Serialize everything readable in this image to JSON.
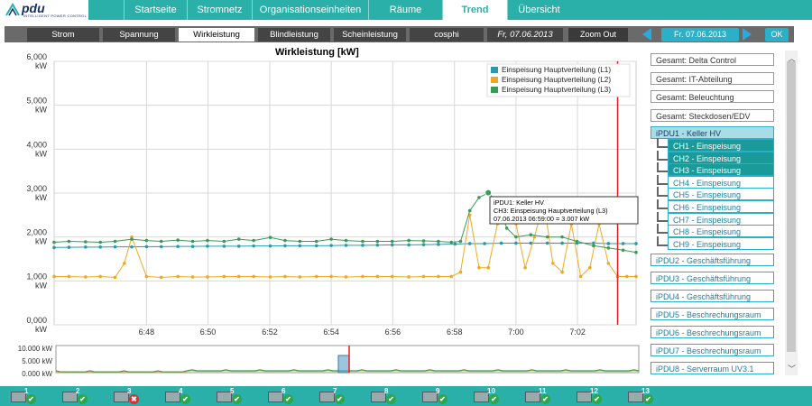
{
  "app": {
    "logo_text": "pdu",
    "logo_sub": "INTELLIGENT POWER CONTROL"
  },
  "nav": {
    "tabs": [
      {
        "label": "Startseite",
        "active": false
      },
      {
        "label": "Stromnetz",
        "active": false
      },
      {
        "label": "Organisationseinheiten",
        "active": false
      },
      {
        "label": "Räume",
        "active": false
      },
      {
        "label": "Trend",
        "active": true
      },
      {
        "label": "Übersicht",
        "active": false
      }
    ]
  },
  "subnav": {
    "tabs": [
      {
        "label": "Strom",
        "active": false
      },
      {
        "label": "Spannung",
        "active": false
      },
      {
        "label": "Wirkleistung",
        "active": true
      },
      {
        "label": "Blindleistung",
        "active": false
      },
      {
        "label": "Scheinleistung",
        "active": false
      },
      {
        "label": "cosphi",
        "active": false
      }
    ],
    "date_label": "Fr, 07.06.2013",
    "zoom_out": "Zoom Out",
    "date_picker": "Fr. 07.06.2013",
    "ok": "OK"
  },
  "chart_data": {
    "type": "line",
    "title": "Wirkleistung [kW]",
    "ylim": [
      0,
      6000
    ],
    "y_ticks": [
      {
        "value": 0,
        "label": "0,000",
        "unit": "kW"
      },
      {
        "value": 1000,
        "label": "1,000",
        "unit": "kW"
      },
      {
        "value": 2000,
        "label": "2,000",
        "unit": "kW"
      },
      {
        "value": 3000,
        "label": "3,000",
        "unit": "kW"
      },
      {
        "value": 4000,
        "label": "4,000",
        "unit": "kW"
      },
      {
        "value": 5000,
        "label": "5,000",
        "unit": "kW"
      },
      {
        "value": 6000,
        "label": "6,000",
        "unit": "kW"
      }
    ],
    "xlim": [
      6.75,
      7.065
    ],
    "x_ticks": [
      {
        "value": 6.8,
        "label": "6:48"
      },
      {
        "value": 6.8333,
        "label": "6:50"
      },
      {
        "value": 6.8667,
        "label": "6:52"
      },
      {
        "value": 6.9,
        "label": "6:54"
      },
      {
        "value": 6.9333,
        "label": "6:56"
      },
      {
        "value": 6.9667,
        "label": "6:58"
      },
      {
        "value": 7.0,
        "label": "7:00"
      },
      {
        "value": 7.0333,
        "label": "7:02"
      }
    ],
    "grid": true,
    "legend_position": "top-right",
    "cursor_x": 7.055,
    "series": [
      {
        "name": "Einspeisung Hauptverteilung (L1)",
        "color": "#2a9aaa",
        "x": [
          6.75,
          6.758,
          6.767,
          6.775,
          6.783,
          6.792,
          6.8,
          6.808,
          6.817,
          6.825,
          6.833,
          6.842,
          6.85,
          6.858,
          6.867,
          6.875,
          6.883,
          6.892,
          6.9,
          6.908,
          6.917,
          6.925,
          6.933,
          6.942,
          6.95,
          6.958,
          6.967,
          6.975,
          6.983,
          6.992,
          7.0,
          7.008,
          7.017,
          7.025,
          7.033,
          7.042,
          7.05,
          7.058,
          7.065
        ],
        "values": [
          1760,
          1765,
          1770,
          1770,
          1775,
          1775,
          1780,
          1780,
          1785,
          1785,
          1790,
          1790,
          1790,
          1795,
          1795,
          1800,
          1800,
          1800,
          1805,
          1810,
          1810,
          1815,
          1820,
          1820,
          1825,
          1830,
          1840,
          1850,
          1850,
          1860,
          1860,
          1860,
          1860,
          1860,
          1860,
          1860,
          1850,
          1850,
          1850
        ]
      },
      {
        "name": "Einspeisung Hauptverteilung (L2)",
        "color": "#f0aa20",
        "x": [
          6.75,
          6.758,
          6.767,
          6.775,
          6.783,
          6.788,
          6.792,
          6.8,
          6.808,
          6.817,
          6.825,
          6.833,
          6.842,
          6.85,
          6.858,
          6.867,
          6.875,
          6.883,
          6.892,
          6.9,
          6.908,
          6.917,
          6.925,
          6.933,
          6.942,
          6.95,
          6.958,
          6.965,
          6.97,
          6.975,
          6.98,
          6.985,
          6.99,
          6.995,
          7.0,
          7.005,
          7.01,
          7.015,
          7.02,
          7.025,
          7.03,
          7.035,
          7.04,
          7.045,
          7.05,
          7.055,
          7.06,
          7.065
        ],
        "values": [
          1100,
          1100,
          1090,
          1100,
          1080,
          1400,
          2000,
          1100,
          1080,
          1100,
          1090,
          1090,
          1100,
          1100,
          1100,
          1090,
          1100,
          1090,
          1100,
          1100,
          1090,
          1100,
          1100,
          1100,
          1090,
          1100,
          1100,
          1100,
          1200,
          2500,
          1300,
          1300,
          2300,
          2500,
          2300,
          1300,
          2000,
          2800,
          1400,
          1200,
          2300,
          1100,
          1300,
          2300,
          1400,
          1100,
          1100,
          1100
        ]
      },
      {
        "name": "Einspeisung Hauptverteilung (L3)",
        "color": "#3a9a58",
        "x": [
          6.75,
          6.758,
          6.767,
          6.775,
          6.783,
          6.792,
          6.8,
          6.808,
          6.817,
          6.825,
          6.833,
          6.842,
          6.85,
          6.858,
          6.867,
          6.875,
          6.883,
          6.892,
          6.9,
          6.908,
          6.917,
          6.925,
          6.933,
          6.942,
          6.95,
          6.958,
          6.965,
          6.97,
          6.975,
          6.98,
          6.985,
          6.99,
          6.995,
          7.0,
          7.008,
          7.017,
          7.025,
          7.033,
          7.042,
          7.05,
          7.058,
          7.065
        ],
        "values": [
          1880,
          1900,
          1890,
          1880,
          1900,
          1950,
          1920,
          1900,
          1930,
          1900,
          1920,
          1900,
          1950,
          1920,
          1990,
          1920,
          1900,
          1900,
          1950,
          1920,
          1900,
          1900,
          1900,
          1920,
          1910,
          1900,
          1880,
          1900,
          2600,
          2900,
          3007,
          2800,
          2200,
          2000,
          2050,
          2000,
          2000,
          1900,
          1800,
          1750,
          1700,
          1650
        ]
      }
    ],
    "tooltip": {
      "line1": "iPDU1: Keller HV",
      "line2": "CH3:  Einspeisung Hauptverteilung (L3)",
      "line3": "07.06.2013    06:59:00  =  3.007 kW",
      "x": 6.985,
      "y": 3007
    }
  },
  "overview": {
    "y_labels": [
      "10.000 kW",
      "5.000 kW",
      "0.000 kW"
    ]
  },
  "sidebar": {
    "groups": [
      "Gesamt: Delta Control",
      "Gesamt: IT-Abteilung",
      "Gesamt: Beleuchtung",
      "Gesamt: Steckdosen/EDV"
    ],
    "selected_device": "iPDU1 - Keller HV",
    "channels": [
      {
        "label": "CH1 - Einspeisung",
        "on": true
      },
      {
        "label": "CH2 - Einspeisung",
        "on": true
      },
      {
        "label": "CH3 - Einspeisung",
        "on": true
      },
      {
        "label": "CH4 - Einspeisung",
        "on": false
      },
      {
        "label": "CH5 - Einspeisung",
        "on": false
      },
      {
        "label": "CH6 - Einspeisung",
        "on": false
      },
      {
        "label": "CH7 - Einspeisung",
        "on": false
      },
      {
        "label": "CH8 - Einspeisung",
        "on": false
      },
      {
        "label": "CH9 - Einspeisung",
        "on": false
      }
    ],
    "devices": [
      "iPDU2 - Geschäftsführung",
      "iPDU3 - Geschäftsführung",
      "iPDU4 - Geschäftsführung",
      "iPDU5 - Beschrechungsraum",
      "iPDU6 - Beschrechungsraum",
      "iPDU7 - Beschrechungsraum",
      "iPDU8 - Serverraum UV3.1"
    ]
  },
  "status_bar": {
    "devices": [
      {
        "num": "1",
        "ok": true
      },
      {
        "num": "2",
        "ok": true
      },
      {
        "num": "3",
        "ok": false
      },
      {
        "num": "4",
        "ok": true
      },
      {
        "num": "5",
        "ok": true
      },
      {
        "num": "6",
        "ok": true
      },
      {
        "num": "7",
        "ok": true
      },
      {
        "num": "8",
        "ok": true
      },
      {
        "num": "9",
        "ok": true
      },
      {
        "num": "10",
        "ok": true
      },
      {
        "num": "11",
        "ok": true
      },
      {
        "num": "12",
        "ok": true
      },
      {
        "num": "13",
        "ok": true
      }
    ]
  }
}
